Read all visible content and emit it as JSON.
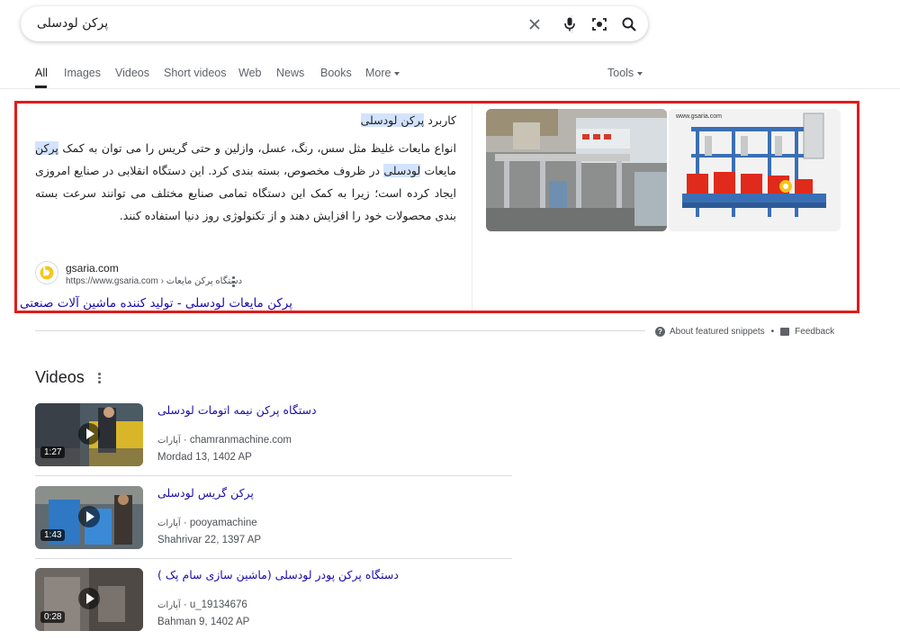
{
  "search": {
    "query": "پرکن لودسلی"
  },
  "tabs": [
    {
      "label": "All"
    },
    {
      "label": "Images"
    },
    {
      "label": "Videos"
    },
    {
      "label": "Short videos"
    },
    {
      "label": "Web"
    },
    {
      "label": "News"
    },
    {
      "label": "Books"
    },
    {
      "label": "More"
    }
  ],
  "tools_label": "Tools",
  "snippet": {
    "heading_prefix": "کاربرد",
    "heading_highlight": "پرکن لودسلی",
    "body_1": "انواع مایعات غلیظ مثل سس، رنگ، عسل، وازلین و حتی گریس را می توان به کمک",
    "body_hl_1": "پرکن",
    "body_2": "مایعات",
    "body_hl_2": "لودسلی",
    "body_3": "در ظروف مخصوص، بسته بندی کرد. این دستگاه انقلابی در صنایع امروزی ایجاد کرده است؛ زیرا به کمک این دستگاه تمامی صنایع مختلف می توانند سرعت بسته بندی محصولات خود را افزایش دهند و از تکنولوژی روز دنیا استفاده کنند.",
    "site_name": "gsaria.com",
    "site_url": "https://www.gsaria.com › دستگاه پرکن مایعات",
    "link": "پرکن مایعات لودسلی - تولید کننده ماشین آلات صنعتی",
    "image2_caption": "www.gsaria.com"
  },
  "about_label": "About featured snippets",
  "feedback_label": "Feedback",
  "videos": {
    "title": "Videos",
    "items": [
      {
        "title": "دستگاه پرکن نیمه اتومات لودسلی",
        "source": "آپارات",
        "channel": "chamranmachine.com",
        "date": "Mordad 13, 1402 AP",
        "duration": "1:27"
      },
      {
        "title": "پرکن گریس لودسلی",
        "source": "آپارات",
        "channel": "pooyamachine",
        "date": "Shahrivar 22, 1397 AP",
        "duration": "1:43"
      },
      {
        "title": "دستگاه پرکن پودر لودسلی (ماشین سازی سام پک )",
        "source": "آپارات",
        "channel": "u_19134676",
        "date": "Bahman 9, 1402 AP",
        "duration": "0:28"
      }
    ]
  }
}
